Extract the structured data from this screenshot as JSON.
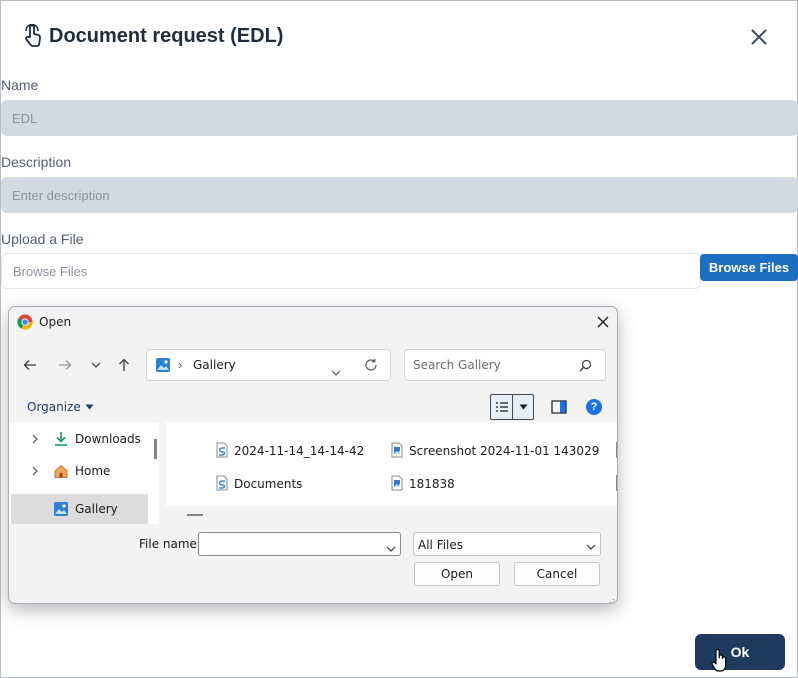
{
  "modal": {
    "title": "Document request (EDL)",
    "name_label": "Name",
    "name_value": "EDL",
    "description_label": "Description",
    "description_placeholder": "Enter description",
    "upload_label": "Upload a File",
    "upload_placeholder": "Browse Files",
    "browse_button": "Browse Files",
    "ok_button": "Ok"
  },
  "dialog": {
    "title": "Open",
    "address": {
      "separator": "›",
      "location": "Gallery"
    },
    "search_placeholder": "Search Gallery",
    "organize_label": "Organize",
    "nav_items": [
      {
        "label": "Downloads",
        "icon": "download-icon"
      },
      {
        "label": "Home",
        "icon": "home-icon"
      },
      {
        "label": "Gallery",
        "icon": "gallery-icon"
      }
    ],
    "files": [
      {
        "name": "2024-11-14_14-14-42",
        "icon": "document-icon"
      },
      {
        "name": "Screenshot 2024-11-01 143029",
        "icon": "image-file-icon"
      },
      {
        "name": "Documents",
        "icon": "document-icon"
      },
      {
        "name": "181838",
        "icon": "image-file-icon"
      }
    ],
    "file_name_label": "File name:",
    "file_name_value": "",
    "file_type": "All Files",
    "open_button": "Open",
    "cancel_button": "Cancel",
    "help_glyph": "?"
  },
  "colors": {
    "primary": "#1b6ec2",
    "ok_button": "#1e3a5f",
    "input_fill": "#d3d9e0"
  }
}
